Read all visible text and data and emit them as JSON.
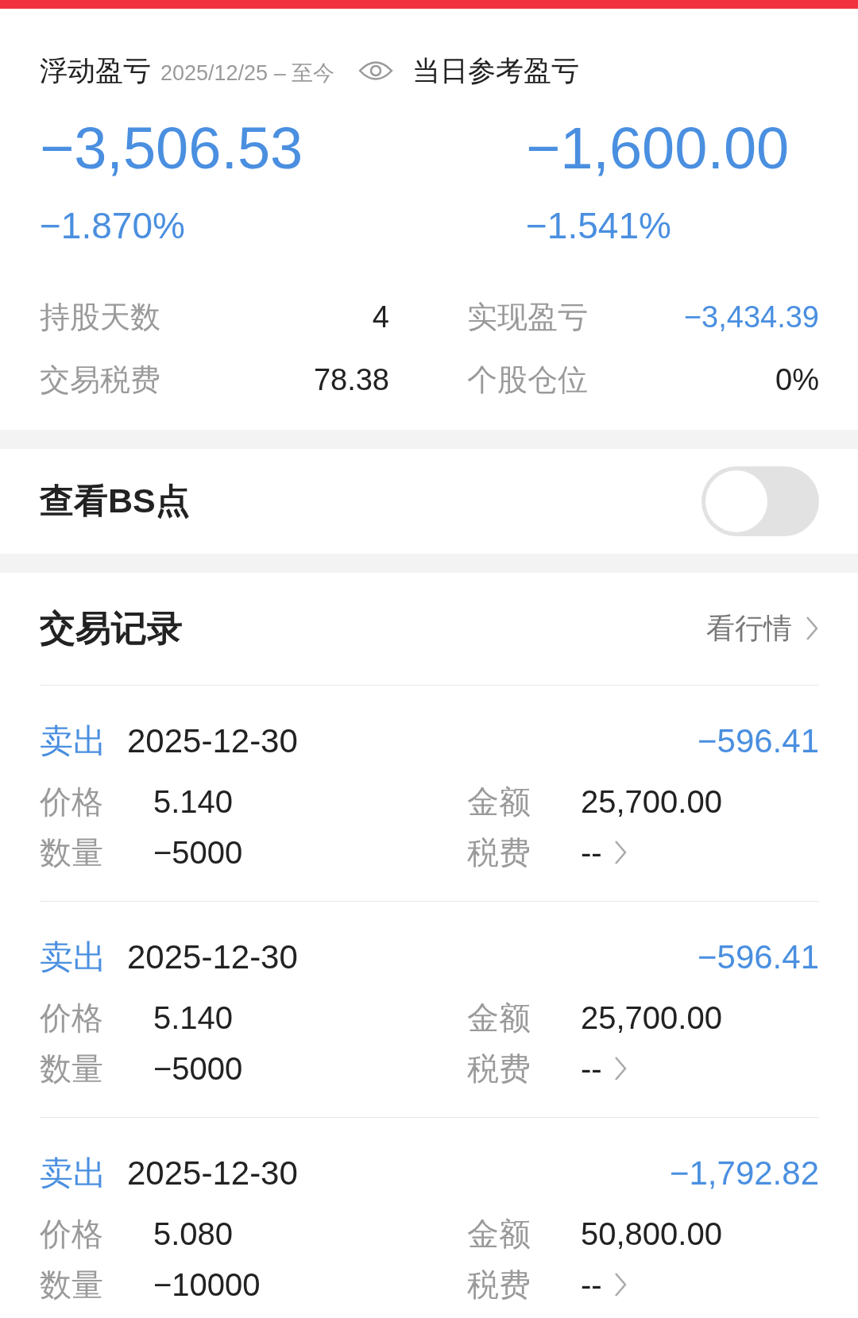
{
  "summary": {
    "floating_label": "浮动盈亏",
    "period": "2025/12/25 – 至今",
    "daily_label": "当日参考盈亏",
    "floating_value": "−3,506.53",
    "daily_value": "−1,600.00",
    "floating_pct": "−1.870%",
    "daily_pct": "−1.541%"
  },
  "stats": [
    {
      "label": "持股天数",
      "value": "4",
      "kind": "plain"
    },
    {
      "label": "实现盈亏",
      "value": "−3,434.39",
      "kind": "loss"
    },
    {
      "label": "交易税费",
      "value": "78.38",
      "kind": "plain"
    },
    {
      "label": "个股仓位",
      "value": "0%",
      "kind": "plain"
    }
  ],
  "bs_toggle": {
    "label": "查看BS点",
    "on": false
  },
  "records": {
    "title": "交易记录",
    "link": "看行情",
    "items": [
      {
        "side": "卖出",
        "date": "2025-12-30",
        "pnl": "−596.41",
        "fields": [
          {
            "label": "价格",
            "value": "5.140",
            "kind": "plain"
          },
          {
            "label": "金额",
            "value": "25,700.00",
            "kind": "plain"
          },
          {
            "label": "数量",
            "value": "−5000",
            "kind": "plain"
          },
          {
            "label": "税费",
            "value": "--",
            "kind": "link"
          }
        ]
      },
      {
        "side": "卖出",
        "date": "2025-12-30",
        "pnl": "−596.41",
        "fields": [
          {
            "label": "价格",
            "value": "5.140",
            "kind": "plain"
          },
          {
            "label": "金额",
            "value": "25,700.00",
            "kind": "plain"
          },
          {
            "label": "数量",
            "value": "−5000",
            "kind": "plain"
          },
          {
            "label": "税费",
            "value": "--",
            "kind": "link"
          }
        ]
      },
      {
        "side": "卖出",
        "date": "2025-12-30",
        "pnl": "−1,792.82",
        "fields": [
          {
            "label": "价格",
            "value": "5.080",
            "kind": "plain"
          },
          {
            "label": "金额",
            "value": "50,800.00",
            "kind": "plain"
          },
          {
            "label": "数量",
            "value": "−10000",
            "kind": "plain"
          },
          {
            "label": "税费",
            "value": "--",
            "kind": "link"
          }
        ]
      }
    ]
  }
}
